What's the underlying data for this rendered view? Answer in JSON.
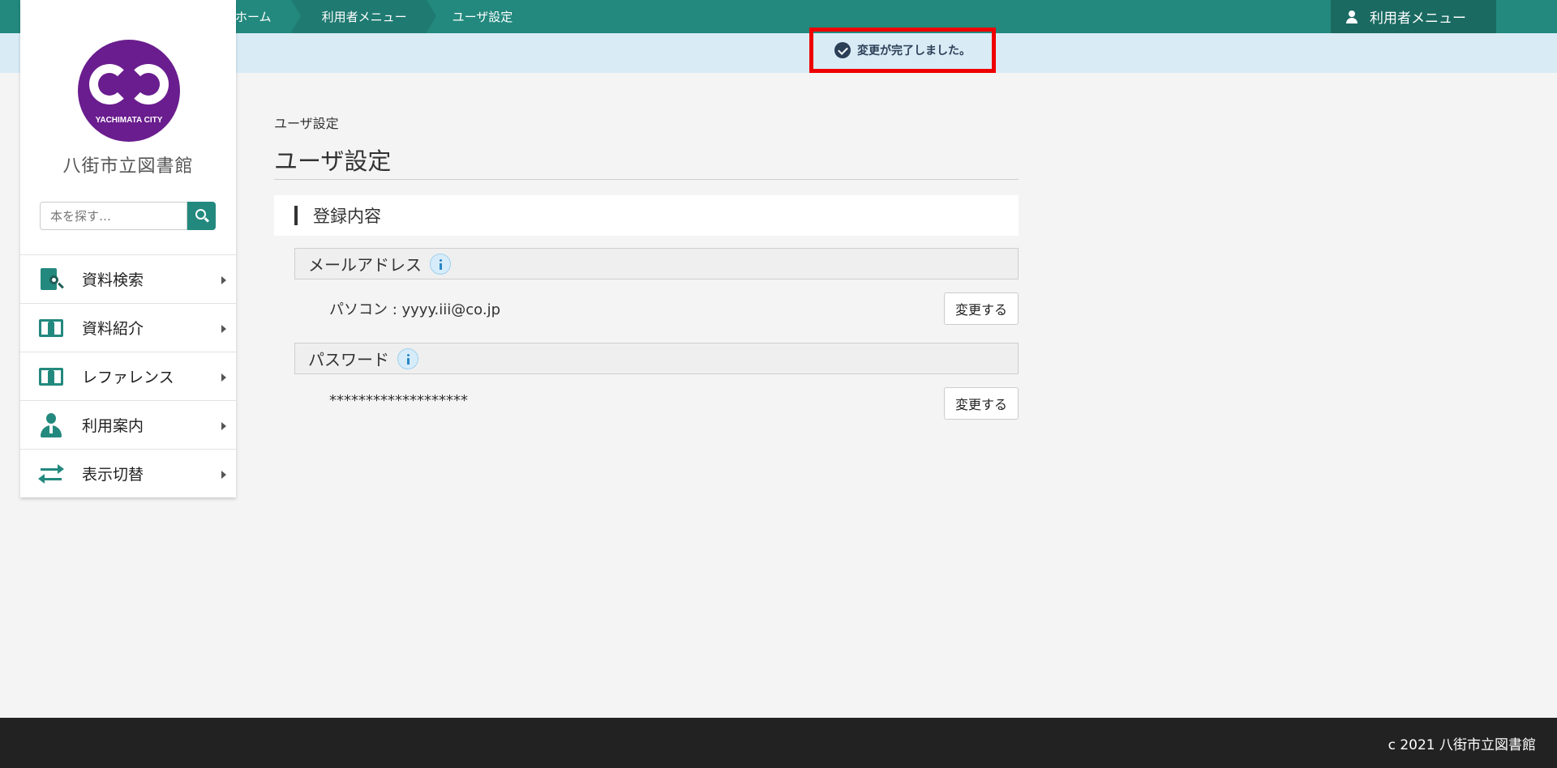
{
  "header": {
    "breadcrumbs": [
      "ホーム",
      "利用者メニュー",
      "ユーザ設定"
    ],
    "user_menu_label": "利用者メニュー",
    "accent_color": "#23897e"
  },
  "notification": {
    "message": "変更が完了しました。"
  },
  "sidebar": {
    "logo_text": "YACHIMATA CITY",
    "library_name": "八街市立図書館",
    "search_placeholder": "本を探す…",
    "items": [
      {
        "label": "資料検索",
        "icon": "document-search-icon"
      },
      {
        "label": "資料紹介",
        "icon": "open-book-icon"
      },
      {
        "label": "レファレンス",
        "icon": "open-book-icon"
      },
      {
        "label": "利用案内",
        "icon": "person-icon"
      },
      {
        "label": "表示切替",
        "icon": "swap-arrows-icon"
      }
    ]
  },
  "main": {
    "breadcrumb": "ユーザ設定",
    "title": "ユーザ設定",
    "section_title": "登録内容",
    "email": {
      "label": "メールアドレス",
      "value": "パソコン : yyyy.iii@co.jp",
      "button": "変更する"
    },
    "password": {
      "label": "パスワード",
      "value": "*******************",
      "button": "変更する"
    }
  },
  "footer": {
    "copyright": "c 2021 八街市立図書館"
  }
}
